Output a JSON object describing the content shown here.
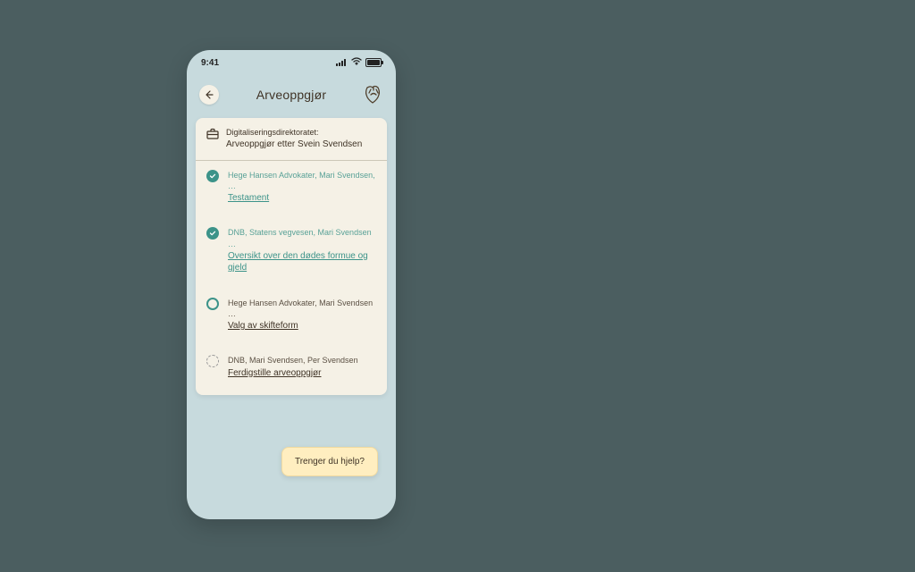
{
  "statusbar": {
    "time": "9:41"
  },
  "header": {
    "title": "Arveoppgjør"
  },
  "card": {
    "org": "Digitaliseringsdirektoratet:",
    "case": "Arveoppgjør etter Svein Svendsen"
  },
  "steps": [
    {
      "status": "done",
      "meta": "Hege Hansen Advokater, Mari Svendsen, …",
      "link": "Testament"
    },
    {
      "status": "done",
      "meta": "DNB, Statens vegvesen, Mari Svendsen …",
      "link": "Oversikt over den dødes formue og gjeld"
    },
    {
      "status": "current",
      "meta": "Hege Hansen Advokater, Mari Svendsen …",
      "link": "Valg av skifteform"
    },
    {
      "status": "future",
      "meta": "DNB, Mari Svendsen, Per Svendsen",
      "link": "Ferdigstille arveoppgjør"
    }
  ],
  "help": {
    "label": "Trenger du hjelp?"
  },
  "colors": {
    "teal": "#3c9389",
    "cardBg": "#f5f1e6",
    "textDark": "#3f3326"
  }
}
